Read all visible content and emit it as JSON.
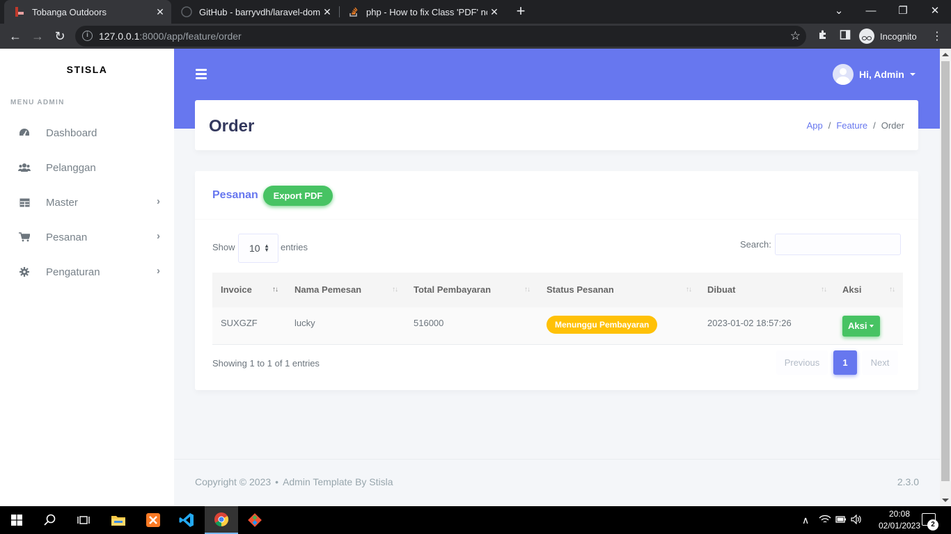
{
  "browser": {
    "tabs": [
      {
        "title": "Tobanga Outdoors",
        "close": "✕",
        "active": true
      },
      {
        "title": "GitHub - barryvdh/laravel-dompd",
        "close": "✕",
        "active": false
      },
      {
        "title": "php - How to fix Class 'PDF' not f",
        "close": "✕",
        "active": false
      }
    ],
    "new_tab": "+",
    "url_host": "127.0.0.1",
    "url_rest": ":8000/app/feature/order",
    "profile_label": "Incognito"
  },
  "sidebar": {
    "brand": "STISLA",
    "menu_header": "MENU ADMIN",
    "items": [
      {
        "label": "Dashboard",
        "icon": "dashboard-icon"
      },
      {
        "label": "Pelanggan",
        "icon": "users-icon"
      },
      {
        "label": "Master",
        "icon": "table-icon",
        "has_children": true
      },
      {
        "label": "Pesanan",
        "icon": "cart-icon",
        "has_children": true
      },
      {
        "label": "Pengaturan",
        "icon": "gear-icon",
        "has_children": true
      }
    ]
  },
  "navbar": {
    "user_greeting": "Hi, Admin"
  },
  "page": {
    "title": "Order",
    "breadcrumb": [
      "App",
      "Feature",
      "Order"
    ]
  },
  "card": {
    "title": "Pesanan",
    "export_button": "Export PDF",
    "show_label": "Show",
    "page_length": "10",
    "entries_label": "entries",
    "search_label": "Search:",
    "search_value": "",
    "columns": [
      "Invoice",
      "Nama Pemesan",
      "Total Pembayaran",
      "Status Pesanan",
      "Dibuat",
      "Aksi"
    ],
    "rows": [
      {
        "invoice": "SUXGZF",
        "nama": "lucky",
        "total": "516000",
        "status": "Menunggu Pembayaran",
        "dibuat": "2023-01-02 18:57:26",
        "aksi": "Aksi"
      }
    ],
    "info": "Showing 1 to 1 of 1 entries",
    "pagination": {
      "previous": "Previous",
      "current": "1",
      "next": "Next"
    }
  },
  "footer": {
    "copyright": "Copyright © 2023",
    "bullet": "•",
    "credit": "Admin Template By Stisla",
    "version": "2.3.0"
  },
  "taskbar": {
    "time": "20:08",
    "date": "02/01/2023",
    "notifications": "2"
  },
  "colors": {
    "primary": "#6777ef",
    "success": "#47c363",
    "warning": "#ffc107"
  }
}
